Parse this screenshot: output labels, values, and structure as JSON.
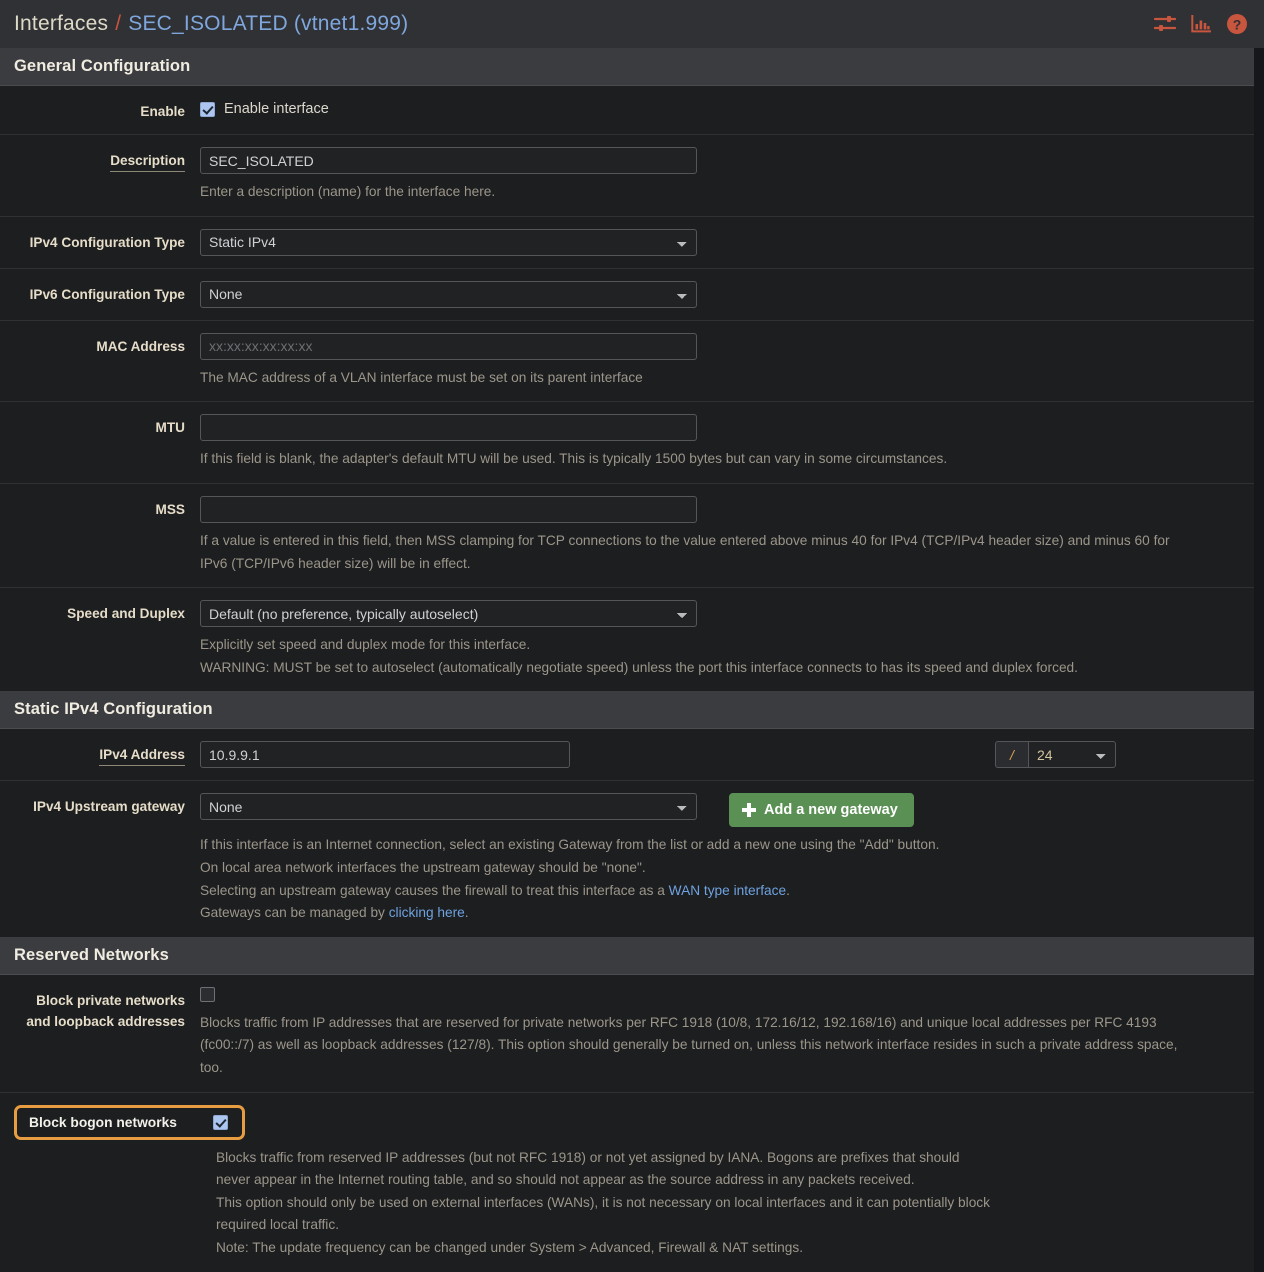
{
  "header": {
    "breadcrumb_root": "Interfaces",
    "breadcrumb_sep": "/",
    "breadcrumb_leaf": "SEC_ISOLATED (vtnet1.999)",
    "icons": [
      "sliders-icon",
      "chart-icon",
      "help-icon"
    ],
    "icon_color": "#c8553d"
  },
  "sections": {
    "general": {
      "title": "General Configuration"
    },
    "static4": {
      "title": "Static IPv4 Configuration"
    },
    "reserved": {
      "title": "Reserved Networks"
    }
  },
  "general": {
    "enable": {
      "label": "Enable",
      "checkbox_label": "Enable interface",
      "checked": true
    },
    "description": {
      "label": "Description",
      "value": "SEC_ISOLATED",
      "placeholder": "",
      "help": "Enter a description (name) for the interface here."
    },
    "ipv4_config_type": {
      "label": "IPv4 Configuration Type",
      "value": "Static IPv4"
    },
    "ipv6_config_type": {
      "label": "IPv6 Configuration Type",
      "value": "None"
    },
    "mac_address": {
      "label": "MAC Address",
      "value": "",
      "placeholder": "xx:xx:xx:xx:xx:xx",
      "help": "The MAC address of a VLAN interface must be set on its parent interface"
    },
    "mtu": {
      "label": "MTU",
      "value": "",
      "help": "If this field is blank, the adapter's default MTU will be used. This is typically 1500 bytes but can vary in some circumstances."
    },
    "mss": {
      "label": "MSS",
      "value": "",
      "help": "If a value is entered in this field, then MSS clamping for TCP connections to the value entered above minus 40 for IPv4 (TCP/IPv4 header size) and minus 60 for IPv6 (TCP/IPv6 header size) will be in effect."
    },
    "speed_duplex": {
      "label": "Speed and Duplex",
      "value": "Default (no preference, typically autoselect)",
      "help_line1": "Explicitly set speed and duplex mode for this interface.",
      "help_line2": "WARNING: MUST be set to autoselect (automatically negotiate speed) unless the port this interface connects to has its speed and duplex forced."
    }
  },
  "static4": {
    "ipv4_address": {
      "label": "IPv4 Address",
      "value": "10.9.9.1",
      "slash": "/",
      "subnet": "24"
    },
    "upstream_gateway": {
      "label": "IPv4 Upstream gateway",
      "value": "None",
      "add_button": "Add a new gateway",
      "help_line1": "If this interface is an Internet connection, select an existing Gateway from the list or add a new one using the \"Add\" button.",
      "help_line2": "On local area network interfaces the upstream gateway should be \"none\".",
      "help_line3_pre": "Selecting an upstream gateway causes the firewall to treat this interface as a ",
      "help_line3_link": "WAN type interface",
      "help_line3_post": ".",
      "help_line4_pre": "Gateways can be managed by ",
      "help_line4_link": "clicking here",
      "help_line4_post": "."
    }
  },
  "reserved": {
    "block_private": {
      "label_line1": "Block private networks",
      "label_line2": "and loopback addresses",
      "checked": false,
      "help": "Blocks traffic from IP addresses that are reserved for private networks per RFC 1918 (10/8, 172.16/12, 192.168/16) and unique local addresses per RFC 4193 (fc00::/7) as well as loopback addresses (127/8). This option should generally be turned on, unless this network interface resides in such a private address space, too."
    },
    "block_bogon": {
      "label": "Block bogon networks",
      "checked": true,
      "highlighted": true,
      "highlight_color": "#e89c42",
      "help_line1": "Blocks traffic from reserved IP addresses (but not RFC 1918) or not yet assigned by IANA. Bogons are prefixes that should never appear in the Internet routing table, and so should not appear as the source address in any packets received.",
      "help_line2": "This option should only be used on external interfaces (WANs), it is not necessary on local interfaces and it can potentially block required local traffic.",
      "help_line3": "Note: The update frequency can be changed under System > Advanced, Firewall & NAT settings."
    }
  }
}
